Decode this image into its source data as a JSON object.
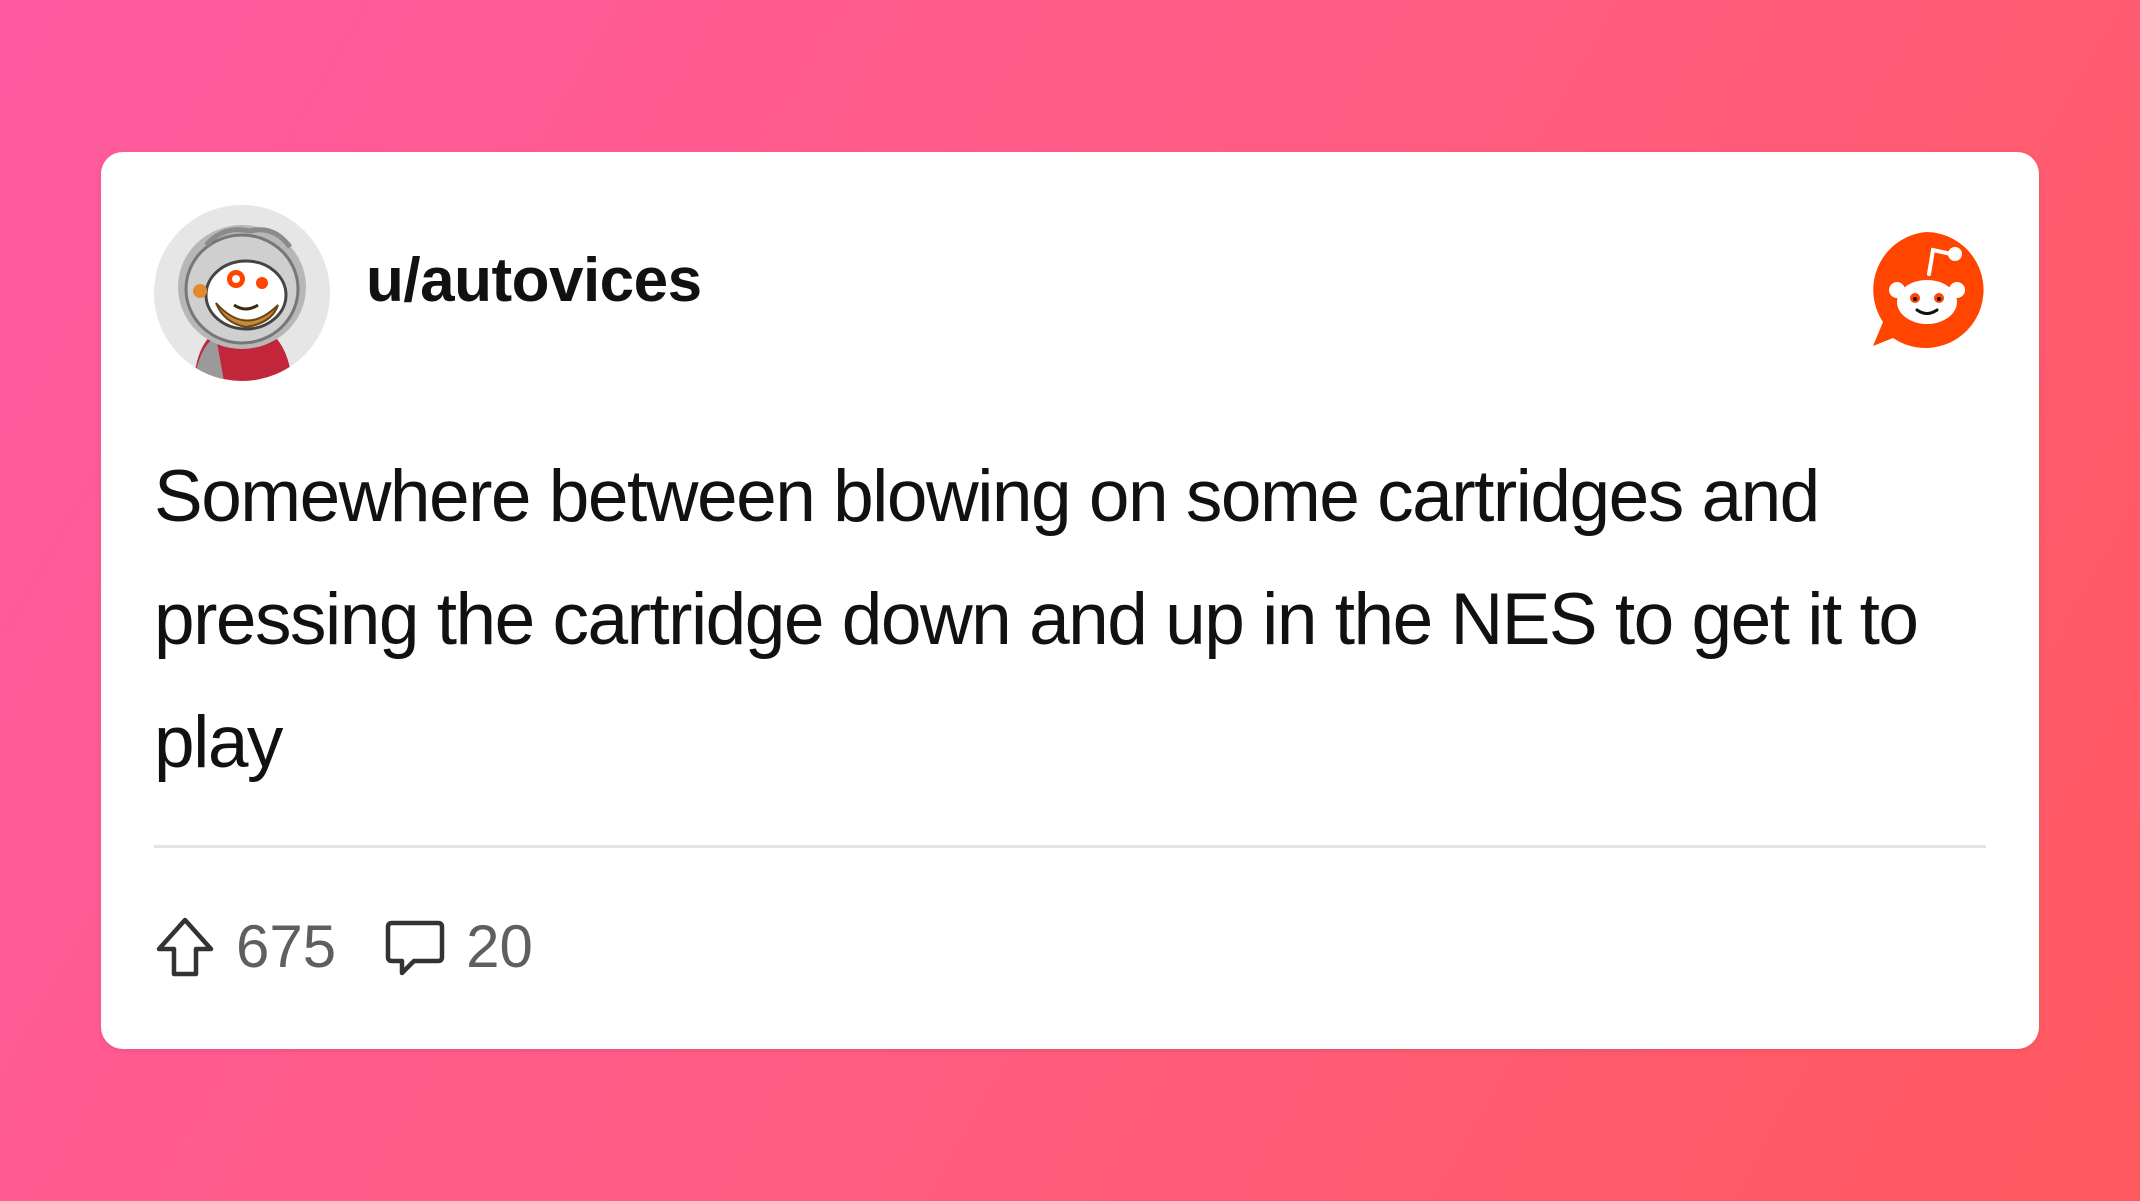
{
  "post": {
    "username": "u/autovices",
    "text": "Somewhere between blowing on some cartridges and pressing the cartridge down and up in the NES to get it to play",
    "upvotes": "675",
    "comments": "20"
  },
  "icons": {
    "avatar": "reddit-snoo-avatar",
    "brand": "reddit-logo-icon",
    "upvote": "upvote-arrow-icon",
    "comment": "comment-bubble-icon"
  },
  "colors": {
    "background_start": "#ff5aa0",
    "background_end": "#ff5a5f",
    "brand_orange": "#ff4500",
    "text": "#111111",
    "stat_text": "#5f5f5f"
  }
}
